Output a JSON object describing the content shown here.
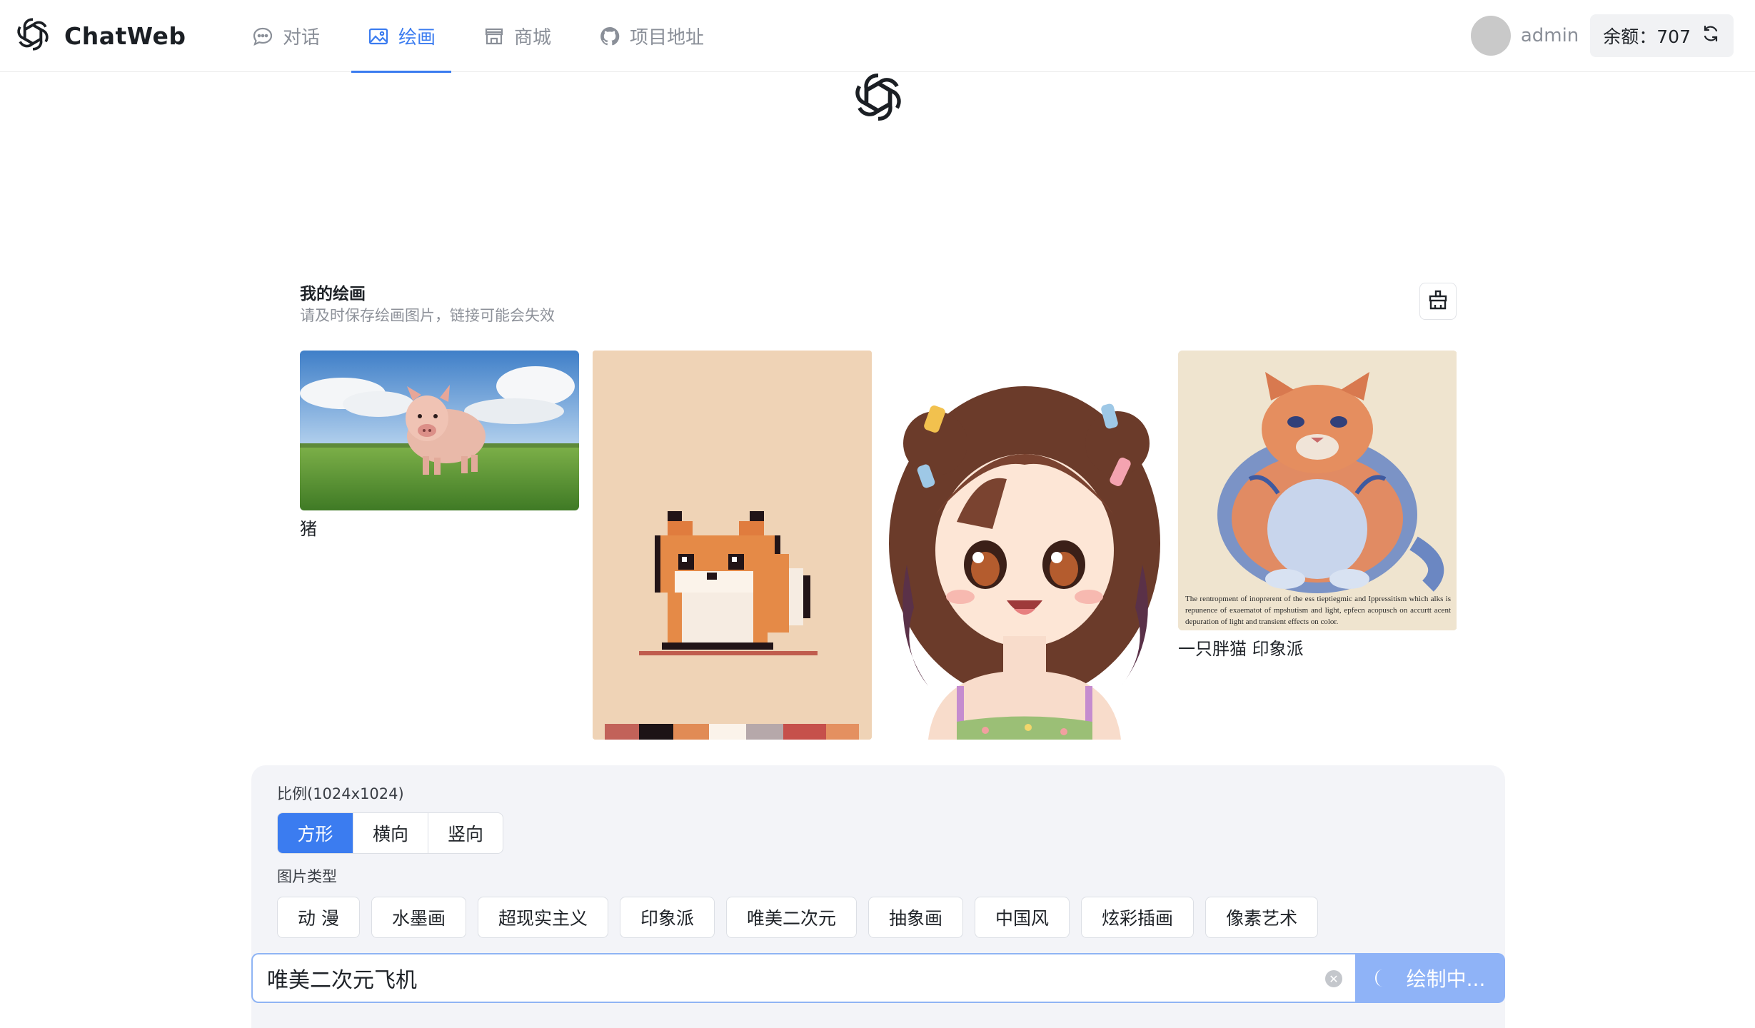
{
  "header": {
    "brand": "ChatWeb",
    "nav": [
      {
        "label": "对话",
        "icon": "chat-icon",
        "active": false
      },
      {
        "label": "绘画",
        "icon": "image-icon",
        "active": true
      },
      {
        "label": "商城",
        "icon": "store-icon",
        "active": false
      },
      {
        "label": "项目地址",
        "icon": "github-icon",
        "active": false
      }
    ],
    "username": "admin",
    "balance_label": "余额：707"
  },
  "gallery": {
    "title": "我的绘画",
    "subtitle": "请及时保存绘画图片，链接可能会失效",
    "items": [
      {
        "caption": "猪",
        "image": "pig-in-meadow"
      },
      {
        "caption": "",
        "image": "pixel-fox"
      },
      {
        "caption": "",
        "image": "anime-girl"
      },
      {
        "caption": "一只胖猫 印象派",
        "image": "fat-cat-impressionist"
      }
    ],
    "cat_image_text": "The rentropment of inoprerent of the ess tieptiegmic and Ippressitism which alks is repunence of exaematot of mpshutism and light, epfecn acopusch on accurtt acent depuration of light and transient effects on color."
  },
  "controls": {
    "ratio_label": "比例(1024x1024)",
    "ratios": [
      "方形",
      "横向",
      "竖向"
    ],
    "ratio_selected": "方形",
    "type_label": "图片类型",
    "styles": [
      "动 漫",
      "水墨画",
      "超现实主义",
      "印象派",
      "唯美二次元",
      "抽象画",
      "中国风",
      "炫彩插画",
      "像素艺术"
    ],
    "prompt_value": "唯美二次元飞机",
    "submit_label": "绘制中..."
  },
  "colors": {
    "accent": "#3b7cf0",
    "submit_loading": "#8fb3f7",
    "panel_bg": "#f3f4f8"
  }
}
